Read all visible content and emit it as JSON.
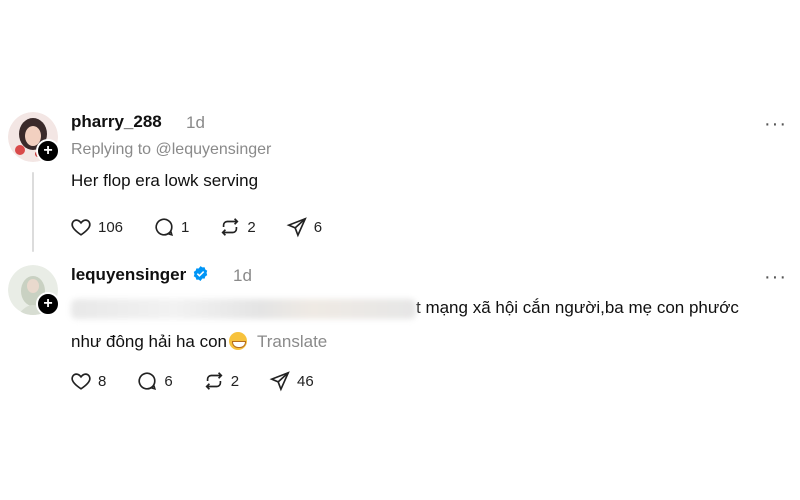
{
  "posts": [
    {
      "username": "pharry_288",
      "time": "1d",
      "replying_to": "Replying to @lequyensinger",
      "text": "Her flop era lowk serving",
      "more": "···",
      "stats": {
        "likes": "106",
        "comments": "1",
        "reposts": "2",
        "shares": "6"
      }
    },
    {
      "username": "lequyensinger",
      "verified": true,
      "time": "1d",
      "text_line1_visible": "t mạng xã hội cắn người,ba mẹ con phước",
      "text_line2": "như đông hải ha con",
      "translate": "Translate",
      "more": "···",
      "stats": {
        "likes": "8",
        "comments": "6",
        "reposts": "2",
        "shares": "46"
      }
    }
  ],
  "colors": {
    "accent_verified": "#0095f6",
    "muted": "#8a8a8a"
  }
}
